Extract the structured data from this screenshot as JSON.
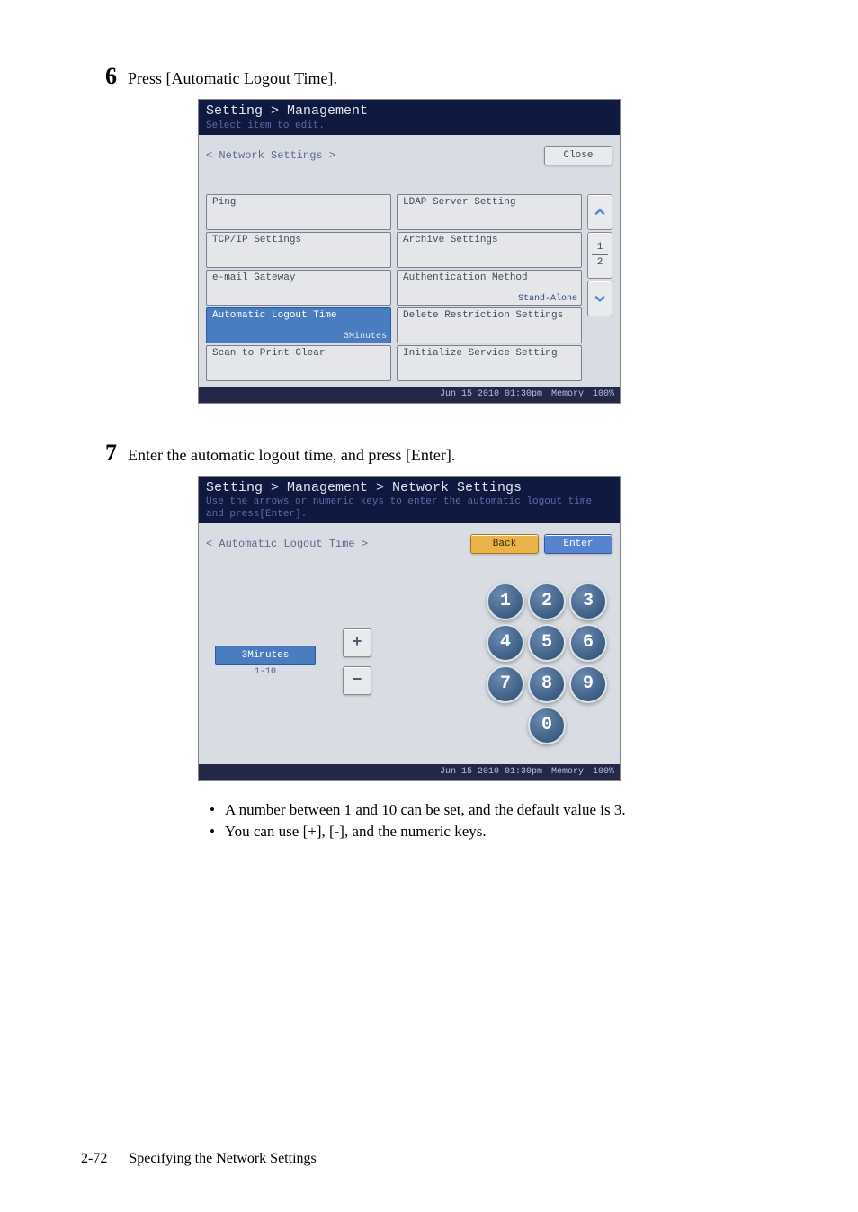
{
  "step6": {
    "num": "6",
    "text": "Press [Automatic Logout Time]."
  },
  "screen1": {
    "breadcrumb": "Setting > Management",
    "hint": "Select item to edit.",
    "section": "< Network Settings >",
    "close": "Close",
    "left": [
      {
        "label": "Ping",
        "sub": ""
      },
      {
        "label": "TCP/IP Settings",
        "sub": ""
      },
      {
        "label": "e-mail Gateway",
        "sub": ""
      },
      {
        "label": "Automatic Logout Time",
        "sub": "3Minutes",
        "selected": true
      },
      {
        "label": "Scan to Print Clear",
        "sub": ""
      }
    ],
    "right": [
      {
        "label": "LDAP Server Setting",
        "sub": ""
      },
      {
        "label": "Archive Settings",
        "sub": ""
      },
      {
        "label": "Authentication Method",
        "sub": "Stand-Alone"
      },
      {
        "label": "Delete Restriction Settings",
        "sub": ""
      },
      {
        "label": "Initialize Service Setting",
        "sub": ""
      }
    ],
    "pager": {
      "cur": "1",
      "tot": "2"
    },
    "status_time": "Jun 15 2010 01:30pm",
    "status_mem": "Memory",
    "status_pct": "100%"
  },
  "step7": {
    "num": "7",
    "text": "Enter the automatic logout time, and press [Enter]."
  },
  "screen2": {
    "breadcrumb": "Setting > Management > Network Settings",
    "hint": "Use the arrows or numeric keys to enter the automatic logout time and press[Enter].",
    "section": "< Automatic Logout Time >",
    "back": "Back",
    "enter": "Enter",
    "value": "3Minutes",
    "range": "1-10",
    "plus": "+",
    "minus": "−",
    "keys": [
      "1",
      "2",
      "3",
      "4",
      "5",
      "6",
      "7",
      "8",
      "9",
      "0"
    ],
    "status_time": "Jun 15 2010 01:30pm",
    "status_mem": "Memory",
    "status_pct": "100%"
  },
  "bullets": [
    "A number between 1 and 10 can be set, and the default value is 3.",
    "You can use [+], [-], and the numeric keys."
  ],
  "footer": {
    "page": "2-72",
    "title": "Specifying the Network Settings"
  }
}
